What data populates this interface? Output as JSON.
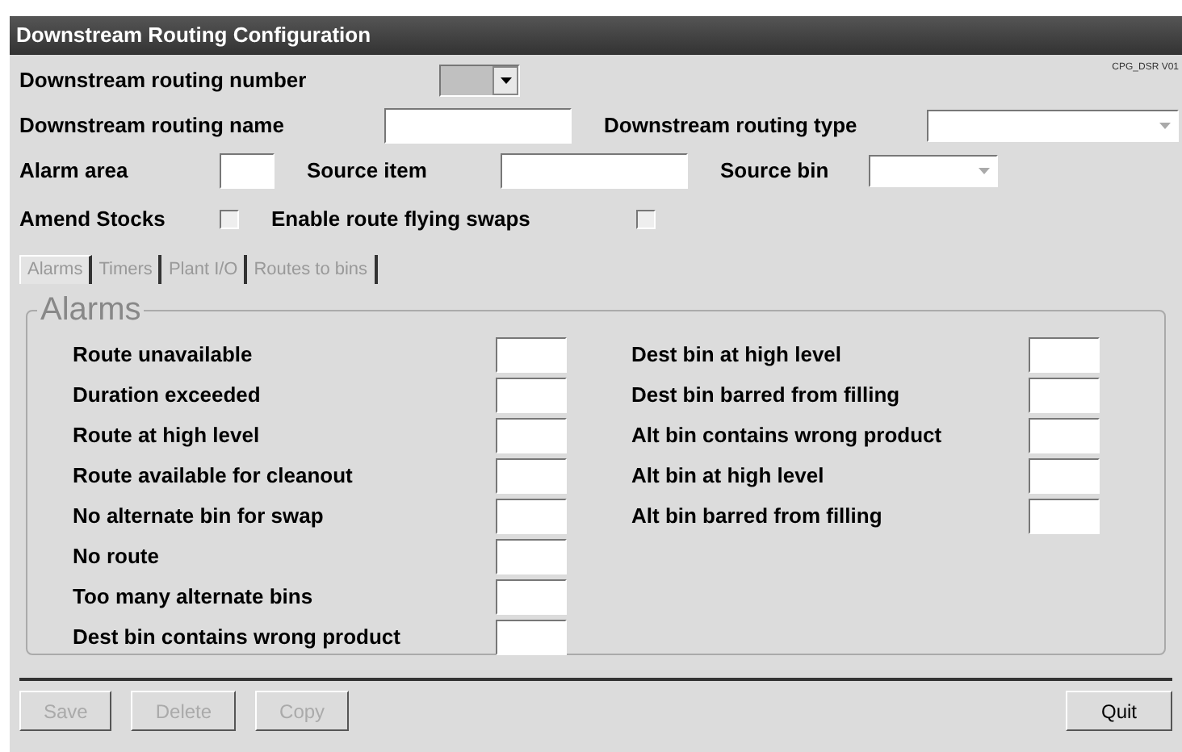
{
  "window": {
    "title": "Downstream Routing Configuration",
    "version": "CPG_DSR V01"
  },
  "fields": [
    {
      "label": "Downstream routing number",
      "kind": "dropdown",
      "disabled": true
    },
    {
      "label": "Downstream routing name",
      "kind": "text"
    },
    {
      "label": "Downstream routing type",
      "kind": "dropdown",
      "disabled": false
    },
    {
      "label": "Alarm area",
      "kind": "text"
    },
    {
      "label": "Source item",
      "kind": "text"
    },
    {
      "label": "Source bin",
      "kind": "dropdown",
      "disabled": false
    },
    {
      "label": "Amend Stocks",
      "kind": "checkbox",
      "checked": false
    },
    {
      "label": "Enable route flying swaps",
      "kind": "checkbox",
      "checked": false
    }
  ],
  "tabs": [
    {
      "label": "Alarms",
      "selected": true
    },
    {
      "label": "Timers",
      "selected": false
    },
    {
      "label": "Plant I/O",
      "selected": false
    },
    {
      "label": "Routes to bins",
      "selected": false
    }
  ],
  "group": {
    "title": "Alarms",
    "left": [
      "Route unavailable",
      "Duration exceeded",
      "Route at high level",
      "Route available for cleanout",
      "No alternate bin for swap",
      "No route",
      "Too many alternate bins",
      "Dest bin contains wrong product"
    ],
    "right": [
      "Dest bin at high level",
      "Dest bin barred from filling",
      "Alt bin contains wrong product",
      "Alt bin at high level",
      "Alt bin barred from filling"
    ]
  },
  "buttons": [
    {
      "label": "Save",
      "disabled": true
    },
    {
      "label": "Delete",
      "disabled": true
    },
    {
      "label": "Copy",
      "disabled": true
    },
    {
      "label": "Quit",
      "disabled": false
    }
  ]
}
